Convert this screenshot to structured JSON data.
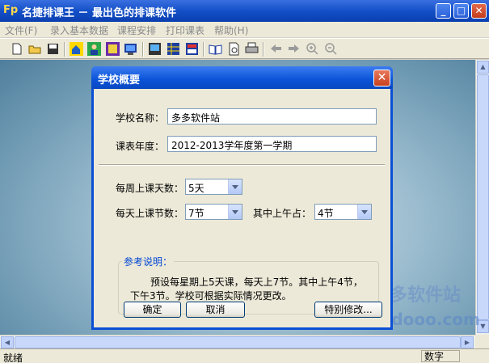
{
  "window": {
    "icon_text": "Fp",
    "title": "名捷排课王 － 最出色的排课软件",
    "min": "_",
    "max": "□",
    "close": "✕"
  },
  "menu": [
    "文件(F)",
    "录入基本数据",
    "课程安排",
    "打印课表",
    "帮助(H)"
  ],
  "toolbar_icons": [
    "new-icon",
    "open-icon",
    "save-icon",
    "home-icon",
    "teacher-icon",
    "class-icon",
    "course-icon",
    "room-icon",
    "table-icon",
    "schedule-icon",
    "report-icon",
    "book-icon",
    "preview-icon",
    "print-icon",
    "back-icon",
    "forward-icon",
    "zoom-in-icon",
    "zoom-out-icon"
  ],
  "dialog": {
    "title": "学校概要",
    "close": "✕",
    "school_name_label": "学校名称：",
    "school_name_value": "多多软件站",
    "year_label": "课表年度：",
    "year_value": "2012-2013学年度第一学期",
    "days_label": "每周上课天数：",
    "days_value": "5天",
    "periods_label": "每天上课节数：",
    "periods_value": "7节",
    "morning_label": "其中上午占：",
    "morning_value": "4节",
    "group_title": "参考说明：",
    "note_line1": "预设每星期上5天课，每天上7节。其中上午4节，",
    "note_line2": "下午3节。学校可根据实际情况更改。",
    "ok": "确定",
    "cancel": "取消",
    "special": "特别修改..."
  },
  "status": {
    "left": "就绪",
    "right": "数字"
  },
  "watermark": {
    "text": "多多软件站",
    "url": "ddooo.com"
  }
}
